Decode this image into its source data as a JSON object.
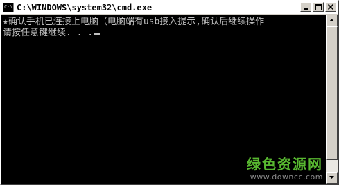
{
  "window": {
    "title": "C:\\WINDOWS\\system32\\cmd.exe",
    "icon_label": "C:\\",
    "icon": "cmd-console-icon"
  },
  "controls": {
    "minimize": "minimize-icon",
    "maximize": "maximize-icon",
    "close": "close-icon"
  },
  "console": {
    "lines": [
      "★确认手机已连接上电脑（电脑端有usb接入提示,确认后继续操作",
      "请按任意键继续. . ."
    ]
  },
  "scrollbar": {
    "up": "scroll-up-arrow-icon",
    "down": "scroll-down-arrow-icon"
  },
  "watermark": {
    "title": "绿色资源网",
    "url": "www.downcc.com"
  },
  "colors": {
    "console_bg": "#000000",
    "console_fg": "#c0c0c0",
    "titlebar_bg": "#ffffff",
    "chrome": "#d4d0c8",
    "watermark_green": "#58b830"
  }
}
